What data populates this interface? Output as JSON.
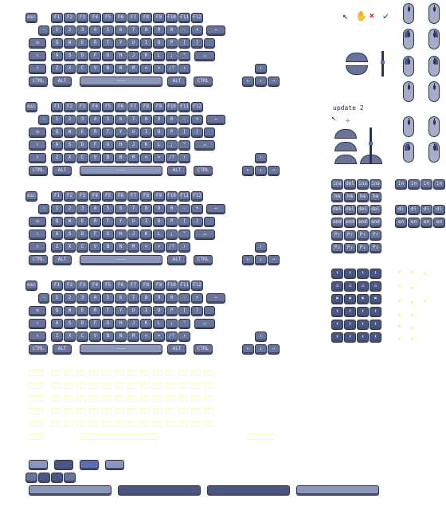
{
  "keyboard": {
    "row_fn": [
      "esc",
      "F1",
      "F2",
      "F3",
      "F4",
      "F5",
      "F6",
      "F7",
      "F8",
      "F9",
      "F10",
      "F11",
      "F12"
    ],
    "row_num": [
      "~",
      "1",
      "2",
      "3",
      "4",
      "5",
      "6",
      "7",
      "8",
      "9",
      "0",
      "-",
      "+",
      "←"
    ],
    "row_q": [
      "⇆",
      "Q",
      "W",
      "E",
      "R",
      "T",
      "Y",
      "U",
      "I",
      "O",
      "P",
      "[",
      "]"
    ],
    "row_a": [
      "⇪",
      "A",
      "S",
      "D",
      "F",
      "G",
      "H",
      "J",
      "K",
      "L",
      ";",
      "\"",
      "↵"
    ],
    "row_z": [
      "↑",
      "Z",
      "X",
      "C",
      "V",
      "B",
      "N",
      "M",
      "<",
      ">",
      "/?",
      "↑"
    ],
    "row_mod": [
      "CTRL",
      "ALT",
      "ALT",
      "CTRL"
    ],
    "arrows": [
      "↑",
      "←",
      "↓",
      "→"
    ]
  },
  "label": "update 2",
  "mouse_icons": {
    "cursor": "↖",
    "hand": "✋",
    "cross": "✖",
    "check": "✔",
    "cursor2": "↖",
    "move": "✛"
  },
  "numpad": {
    "top": [
      "ins",
      "del",
      "ins",
      "ins"
    ],
    "rows": [
      "hm",
      "hm",
      "hm",
      "hm",
      "del",
      "del",
      "del",
      "del",
      "end",
      "end",
      "end",
      "end",
      "P↑",
      "P↑",
      "P↑",
      "P↑",
      "P↓",
      "P↓",
      "P↓",
      "P↓"
    ],
    "right": [
      "in",
      "in",
      "in",
      "in",
      "dl",
      "dl",
      "dl",
      "dl",
      "en",
      "en",
      "en",
      "en"
    ]
  },
  "icon_pad": [
    "⬇",
    "⬇",
    "⬇",
    "⬇",
    "⌂",
    "⌂",
    "⌂",
    "⌂",
    "✖",
    "✖",
    "✖",
    "✖",
    "⬆",
    "⬆",
    "⬆",
    "⬆",
    "⬆",
    "⬆",
    "⬆",
    "⬆",
    "⬇",
    "⬇",
    "⬇",
    "⬇"
  ],
  "colors": {
    "key": "#6a7398",
    "key_dark": "#4d5680",
    "key_light": "#8e96b8",
    "outline": "#2c3350",
    "ghost": "#f2efb8"
  }
}
